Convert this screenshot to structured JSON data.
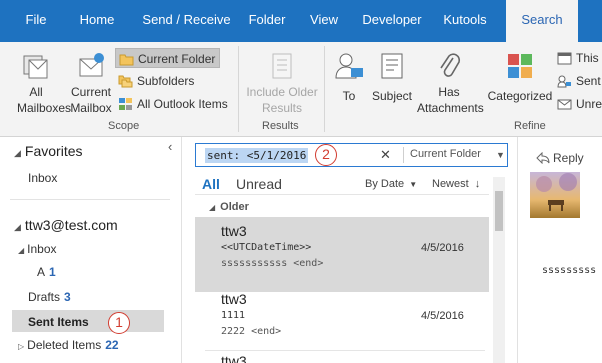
{
  "tabs": [
    {
      "label": "File"
    },
    {
      "label": "Home"
    },
    {
      "label": "Send / Receive"
    },
    {
      "label": "Folder"
    },
    {
      "label": "View"
    },
    {
      "label": "Developer"
    },
    {
      "label": "Kutools"
    },
    {
      "label": "Search"
    }
  ],
  "ribbon": {
    "scope": {
      "all_mailboxes": "All Mailboxes",
      "current_mailbox": "Current Mailbox",
      "current_folder": "Current Folder",
      "subfolders": "Subfolders",
      "all_outlook_items": "All Outlook Items",
      "label": "Scope"
    },
    "results": {
      "include_older_results": "Include Older Results",
      "label": "Results"
    },
    "refine": {
      "to": "To",
      "subject": "Subject",
      "has_attachments": "Has Attachments",
      "categorized": "Categorized",
      "this": "This",
      "sent": "Sent",
      "unread": "Unre",
      "label": "Refine"
    }
  },
  "folders": {
    "favorites_header": "Favorites",
    "favorites_inbox": "Inbox",
    "account": "ttw3@test.com",
    "items": [
      {
        "label": "Inbox",
        "count": ""
      },
      {
        "label": "A",
        "count": "1"
      },
      {
        "label": "Drafts",
        "count": "3"
      },
      {
        "label": "Sent Items",
        "count": ""
      },
      {
        "label": "Deleted Items",
        "count": "22"
      }
    ],
    "callout_1": "1"
  },
  "search": {
    "query": "sent: <5/1/2016",
    "scope": "Current Folder",
    "callout_2": "2"
  },
  "list": {
    "filter_all": "All",
    "filter_unread": "Unread",
    "sort_by": "By Date",
    "sort_order": "Newest",
    "group": "Older",
    "messages": [
      {
        "sender": "ttw3",
        "subject": "<<UTCDateTime>>",
        "date": "4/5/2016",
        "preview": "sssssssssss <end>"
      },
      {
        "sender": "ttw3",
        "subject": "1111",
        "date": "4/5/2016",
        "preview": "2222 <end>"
      },
      {
        "sender": "ttw3",
        "subject": "",
        "date": "",
        "preview": ""
      }
    ]
  },
  "reading": {
    "reply": "Reply",
    "body": "sssssssss"
  },
  "colors": {
    "tabbar": "#1e72c0",
    "accent": "#2b66b3",
    "callout": "#d23c30",
    "selection": "#d9d9d9"
  }
}
